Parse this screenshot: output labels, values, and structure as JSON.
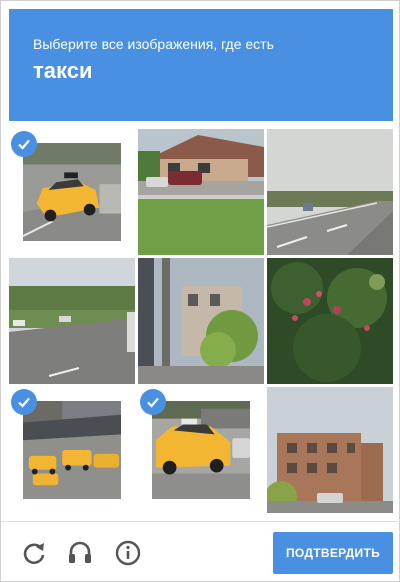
{
  "header": {
    "instruction": "Выберите все изображения, где есть",
    "keyword": "такси"
  },
  "tiles": [
    {
      "id": "taxi-street-1",
      "selected": true
    },
    {
      "id": "house-parking",
      "selected": false
    },
    {
      "id": "highway-1",
      "selected": false
    },
    {
      "id": "highway-2",
      "selected": false
    },
    {
      "id": "street-building",
      "selected": false
    },
    {
      "id": "flowering-bush",
      "selected": false
    },
    {
      "id": "taxi-parking-lot",
      "selected": true
    },
    {
      "id": "taxi-street-2",
      "selected": true
    },
    {
      "id": "brick-building",
      "selected": false
    }
  ],
  "footer": {
    "icons": [
      "reload-icon",
      "audio-icon",
      "info-icon"
    ],
    "verify_label": "ПОДТВЕРДИТЬ"
  },
  "colors": {
    "accent": "#4a90e2",
    "taxi_yellow": "#f2b632"
  }
}
